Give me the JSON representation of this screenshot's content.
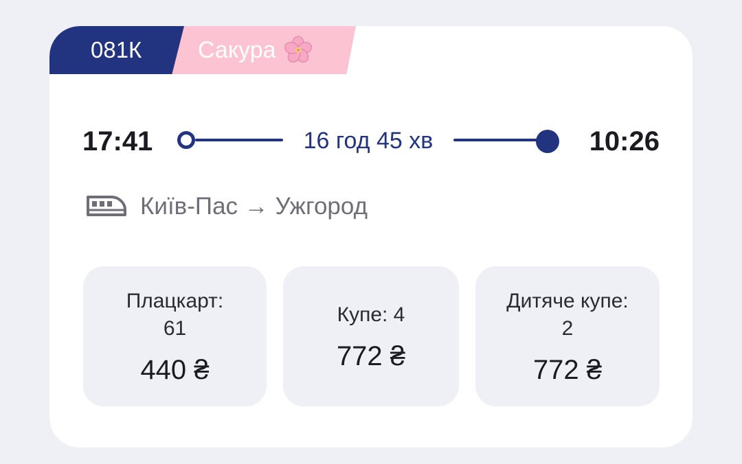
{
  "train": {
    "number": "081К",
    "name": "Сакура",
    "name_icon": "cherry-blossom-icon",
    "name_color": "#fcc4d2",
    "number_color": "#223480"
  },
  "schedule": {
    "departure_time": "17:41",
    "arrival_time": "10:26",
    "duration": "16 год 45 хв"
  },
  "route": {
    "icon": "train-icon",
    "text": "Київ-Пас → Ужгород"
  },
  "classes": [
    {
      "label": "Плацкарт: 61",
      "price": "440 ₴"
    },
    {
      "label": "Купе: 4",
      "price": "772 ₴"
    },
    {
      "label": "Дитяче купе: 2",
      "price": "772 ₴"
    }
  ]
}
